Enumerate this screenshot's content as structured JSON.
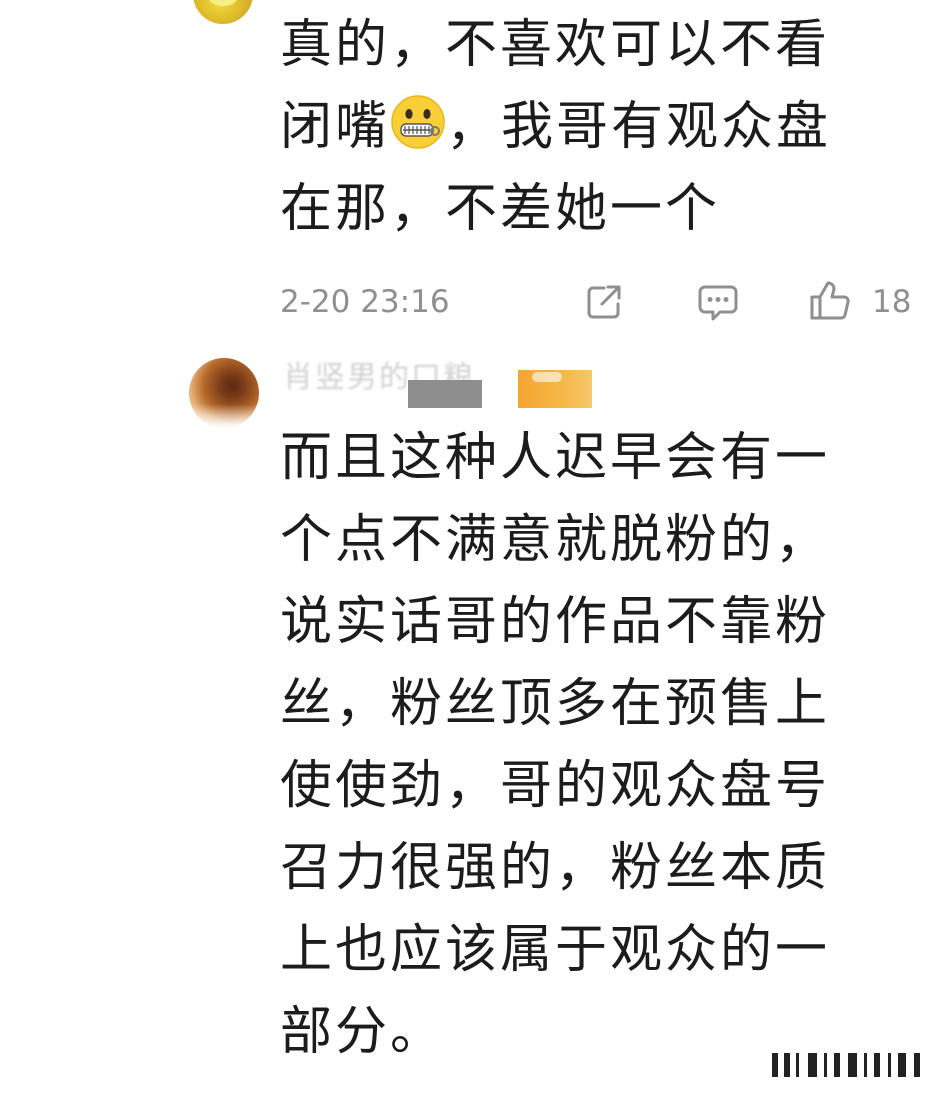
{
  "comments": [
    {
      "lines": [
        "真的，不喜欢可以不看",
        "闭嘴",
        "，我哥有观众盘",
        "在那，不差她一个"
      ],
      "emoji": "zipper-mouth-face",
      "time": "2-20 23:16",
      "likes": "18"
    },
    {
      "username": "肖竖男的口粮",
      "lines": [
        "而且这种人迟早会有一",
        "个点不满意就脱粉的，",
        "说实话哥的作品不靠粉",
        "丝，粉丝顶多在预售上",
        "使使劲，哥的观众盘号",
        "召力很强的，粉丝本质",
        "上也应该属于观众的一",
        "部分。"
      ]
    }
  ],
  "icons": {
    "share": "share-icon",
    "reply": "comment-icon",
    "like": "thumbs-up-icon"
  },
  "colors": {
    "text": "#1c1c1c",
    "meta": "#8f8f8f",
    "badge_orange": "#f6a531",
    "badge_grey": "#8e8e8e"
  }
}
